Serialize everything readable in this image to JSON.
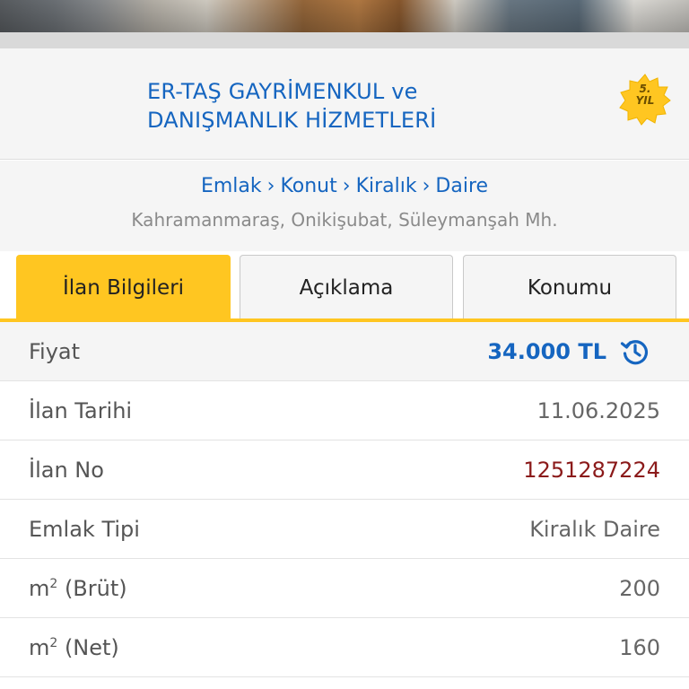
{
  "header": {
    "company_line1": "ER-TAŞ GAYRİMENKUL ve",
    "company_line2": "DANIŞMANLIK HİZMETLERİ",
    "badge": {
      "line1": "5.",
      "line2": "YIL"
    }
  },
  "breadcrumb": [
    "Emlak",
    "Konut",
    "Kiralık",
    "Daire"
  ],
  "location": "Kahramanmaraş, Onikişubat, Süleymanşah Mh.",
  "tabs": [
    {
      "label": "İlan Bilgileri",
      "active": true
    },
    {
      "label": "Açıklama",
      "active": false
    },
    {
      "label": "Konumu",
      "active": false
    }
  ],
  "details": {
    "price": {
      "label": "Fiyat",
      "value": "34.000 TL"
    },
    "date": {
      "label": "İlan Tarihi",
      "value": "11.06.2025"
    },
    "listing_no": {
      "label": "İlan No",
      "value": "1251287224"
    },
    "type": {
      "label": "Emlak Tipi",
      "value": "Kiralık Daire"
    },
    "gross": {
      "label_prefix": "m",
      "label_sup": "2",
      "label_suffix": " (Brüt)",
      "value": "200"
    },
    "net": {
      "label_prefix": "m",
      "label_sup": "2",
      "label_suffix": " (Net)",
      "value": "160"
    }
  },
  "colors": {
    "accent": "#ffc621",
    "link": "#1565c0",
    "listing_no": "#8b1a1a"
  },
  "icons": {
    "price_history": "history-icon",
    "badge": "anniversary-badge-icon",
    "separator": "chevron-right"
  }
}
